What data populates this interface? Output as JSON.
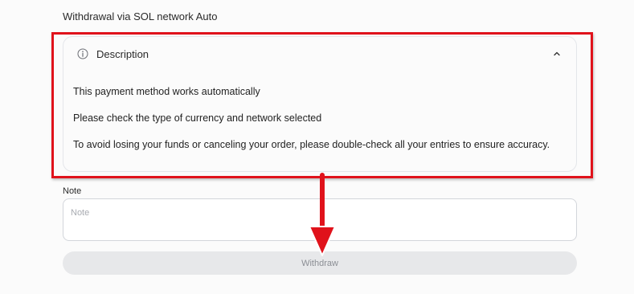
{
  "page": {
    "heading": "Withdrawal via SOL network Auto"
  },
  "description": {
    "title": "Description",
    "expanded": true,
    "header_icon": "info-circle-icon",
    "toggle_icon": "chevron-up-icon",
    "lines": [
      "This payment method works automatically",
      "Please check the type of currency and network selected",
      "To avoid losing your funds or canceling your order, please double-check all your entries to ensure accuracy."
    ]
  },
  "note": {
    "label": "Note",
    "placeholder": "Note",
    "value": ""
  },
  "withdraw": {
    "label": "Withdraw"
  },
  "annotation": {
    "color": "#e0121b",
    "shape": "rectangle-highlight-with-down-arrow"
  }
}
